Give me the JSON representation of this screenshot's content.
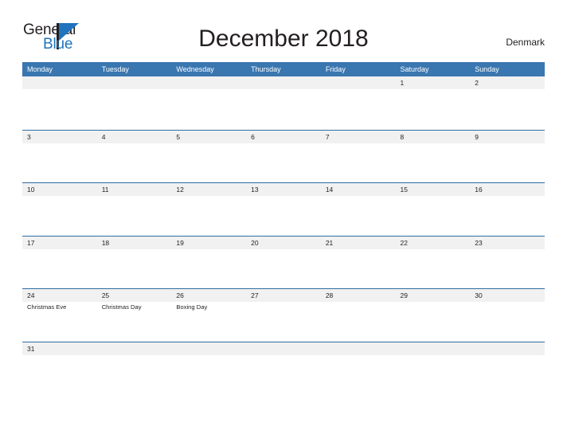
{
  "branding": {
    "logo_text_primary": "General",
    "logo_text_secondary": "Blue",
    "logo_icon": "flag-triangle-icon"
  },
  "header": {
    "title": "December 2018",
    "country": "Denmark"
  },
  "colors": {
    "header_blue": "#3a76b0",
    "grid_line_blue": "#2e6da4",
    "day_band_gray": "#f1f1f1",
    "logo_blue": "#1f74bd",
    "text_dark": "#231f20",
    "background": "#ffffff"
  },
  "calendar": {
    "month": "December",
    "year": "2018",
    "weekday_headers": [
      "Monday",
      "Tuesday",
      "Wednesday",
      "Thursday",
      "Friday",
      "Saturday",
      "Sunday"
    ],
    "weeks": [
      {
        "days": [
          {
            "num": "",
            "event": ""
          },
          {
            "num": "",
            "event": ""
          },
          {
            "num": "",
            "event": ""
          },
          {
            "num": "",
            "event": ""
          },
          {
            "num": "",
            "event": ""
          },
          {
            "num": "1",
            "event": ""
          },
          {
            "num": "2",
            "event": ""
          }
        ]
      },
      {
        "days": [
          {
            "num": "3",
            "event": ""
          },
          {
            "num": "4",
            "event": ""
          },
          {
            "num": "5",
            "event": ""
          },
          {
            "num": "6",
            "event": ""
          },
          {
            "num": "7",
            "event": ""
          },
          {
            "num": "8",
            "event": ""
          },
          {
            "num": "9",
            "event": ""
          }
        ]
      },
      {
        "days": [
          {
            "num": "10",
            "event": ""
          },
          {
            "num": "11",
            "event": ""
          },
          {
            "num": "12",
            "event": ""
          },
          {
            "num": "13",
            "event": ""
          },
          {
            "num": "14",
            "event": ""
          },
          {
            "num": "15",
            "event": ""
          },
          {
            "num": "16",
            "event": ""
          }
        ]
      },
      {
        "days": [
          {
            "num": "17",
            "event": ""
          },
          {
            "num": "18",
            "event": ""
          },
          {
            "num": "19",
            "event": ""
          },
          {
            "num": "20",
            "event": ""
          },
          {
            "num": "21",
            "event": ""
          },
          {
            "num": "22",
            "event": ""
          },
          {
            "num": "23",
            "event": ""
          }
        ]
      },
      {
        "days": [
          {
            "num": "24",
            "event": "Christmas Eve"
          },
          {
            "num": "25",
            "event": "Christmas Day"
          },
          {
            "num": "26",
            "event": "Boxing Day"
          },
          {
            "num": "27",
            "event": ""
          },
          {
            "num": "28",
            "event": ""
          },
          {
            "num": "29",
            "event": ""
          },
          {
            "num": "30",
            "event": ""
          }
        ]
      },
      {
        "days": [
          {
            "num": "31",
            "event": ""
          },
          {
            "num": "",
            "event": ""
          },
          {
            "num": "",
            "event": ""
          },
          {
            "num": "",
            "event": ""
          },
          {
            "num": "",
            "event": ""
          },
          {
            "num": "",
            "event": ""
          },
          {
            "num": "",
            "event": ""
          }
        ]
      }
    ]
  }
}
